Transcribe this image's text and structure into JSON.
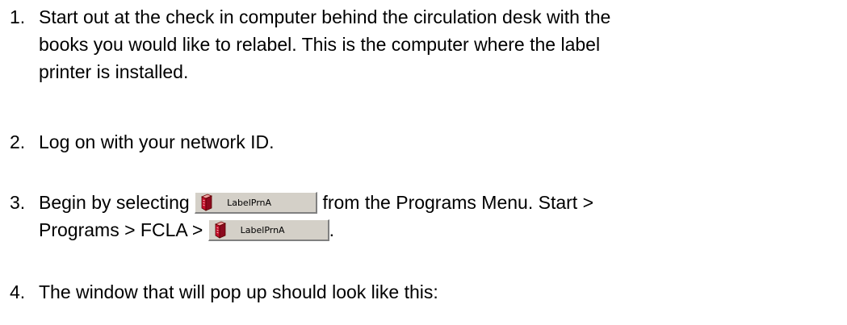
{
  "steps": [
    {
      "number": "1.",
      "lines": [
        "Start out at the check in computer behind the circulation desk with the",
        "books you would like to relabel. This is the computer where the label",
        "printer is installed."
      ]
    },
    {
      "number": "2.",
      "text": "Log on with your network ID."
    },
    {
      "number": "3.",
      "line1_before": "Begin by selecting",
      "line1_after": "from the Programs Menu. Start >",
      "line2_before": "Programs > FCLA >",
      "line2_after": "."
    },
    {
      "number": "4.",
      "text": "The window that will pop up should look like this:"
    }
  ],
  "program_button": {
    "label": "LabelPrnA",
    "icon": "red-book-icon",
    "icon_color": "#c8102e",
    "face_color": "#d4d0c8"
  }
}
